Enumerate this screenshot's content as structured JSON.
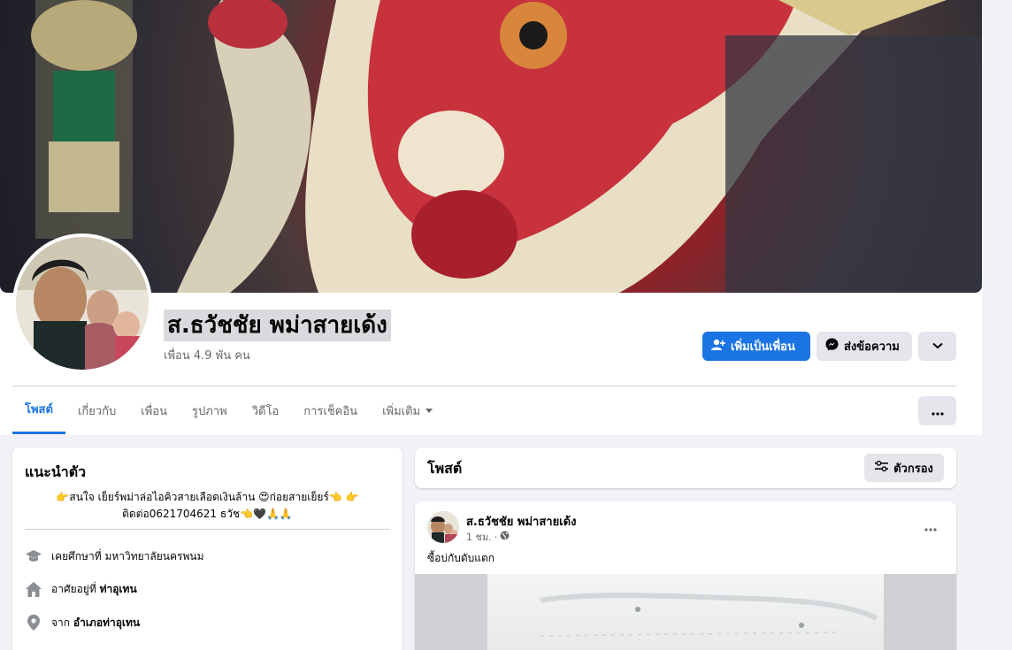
{
  "profile": {
    "name": "ส.ธวัชชัย พม่าสายเด้ง",
    "friends": "เพื่อน 4.9 พัน คน"
  },
  "actions": {
    "add_friend": "เพิ่มเป็นเพื่อน",
    "message": "ส่งข้อความ"
  },
  "tabs": [
    {
      "label": "โพสต์",
      "active": true
    },
    {
      "label": "เกี่ยวกับ"
    },
    {
      "label": "เพื่อน"
    },
    {
      "label": "รูปภาพ"
    },
    {
      "label": "วิดีโอ"
    },
    {
      "label": "การเช็คอิน"
    },
    {
      "label": "เพิ่มเติม"
    }
  ],
  "intro": {
    "title": "แนะนำตัว",
    "bio_line1": "👉สนใจ เย็ยร์พม่าล่อไอคิวสายเลือดเงินล้าน 😍ก่อยสายเย็ยร์👈 👉",
    "bio_line2": "ติดต่อ0621704621 ธวัช👈🖤🙏🙏",
    "education_prefix": "เคยศึกษาที่",
    "education": "มหาวิทยาลัยนครพนม",
    "lives_prefix": "อาศัยอยู่ที่",
    "lives": "ท่าอุเทน",
    "from_prefix": "จาก",
    "from": "อำเภอท่าอุเทน"
  },
  "posts": {
    "title": "โพสต์",
    "filter": "ตัวกรอง",
    "post": {
      "author": "ส.ธวัชชัย พม่าสายเด้ง",
      "time": "1 ชม.",
      "separator": "·",
      "text": "ซื้อบ่กับดับแตก"
    }
  },
  "colors": {
    "accent": "#1b74e4",
    "page_bg": "#f0f2f5",
    "button_gray": "#e4e6eb",
    "text_secondary": "#65676b"
  },
  "icons": [
    "add-friend-icon",
    "messenger-icon",
    "chevron-down-icon",
    "more-dots-icon",
    "filter-icon",
    "graduation-cap-icon",
    "home-icon",
    "location-pin-icon",
    "globe-icon"
  ]
}
